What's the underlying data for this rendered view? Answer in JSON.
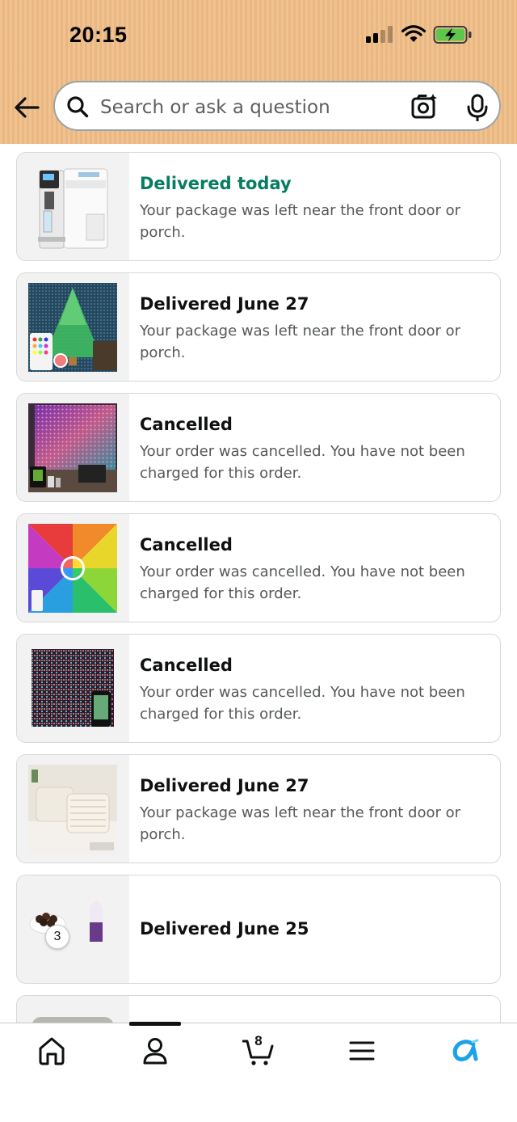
{
  "status_bar": {
    "time": "20:15"
  },
  "search": {
    "placeholder": "Search or ask a question"
  },
  "orders": [
    {
      "status": "Delivered today",
      "detail": "Your package was left near the front door or porch.",
      "status_color": "#067d62",
      "image": "water-dispenser"
    },
    {
      "status": "Delivered June 27",
      "detail": "Your package was left near the front door or porch.",
      "image": "led-curtain-tree"
    },
    {
      "status": "Cancelled",
      "detail": "Your order was cancelled. You have not been charged for this order.",
      "image": "led-curtain-room"
    },
    {
      "status": "Cancelled",
      "detail": "Your order was cancelled. You have not been charged for this order.",
      "image": "led-curtain-rainbow"
    },
    {
      "status": "Cancelled",
      "detail": "Your order was cancelled. You have not been charged for this order.",
      "image": "led-curtain-string"
    },
    {
      "status": "Delivered June 27",
      "detail": "Your package was left near the front door or porch.",
      "image": "pillows"
    },
    {
      "status": "Delivered June 25",
      "detail": "",
      "image": "groceries",
      "item_count": "3"
    }
  ],
  "tabbar": {
    "items": [
      "home-icon",
      "account-icon",
      "cart-icon",
      "menu-icon",
      "rufus-icon"
    ],
    "cart_count": "8",
    "accent": "#1aa3e8"
  }
}
